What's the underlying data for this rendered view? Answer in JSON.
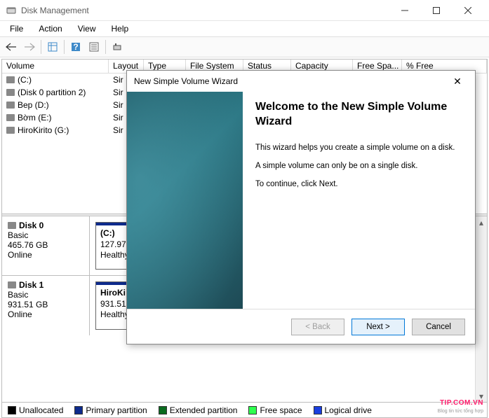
{
  "window": {
    "title": "Disk Management"
  },
  "menu": {
    "file": "File",
    "action": "Action",
    "view": "View",
    "help": "Help"
  },
  "cols": {
    "volume": "Volume",
    "layout": "Layout",
    "type": "Type",
    "filesystem": "File System",
    "status": "Status",
    "capacity": "Capacity",
    "freespace": "Free Spa...",
    "pctfree": "% Free"
  },
  "volumes": [
    {
      "name": "(C:)",
      "layout": "Sir"
    },
    {
      "name": "(Disk 0 partition 2)",
      "layout": "Sir"
    },
    {
      "name": "Bep (D:)",
      "layout": "Sir"
    },
    {
      "name": "Bờm (E:)",
      "layout": "Sir"
    },
    {
      "name": "HiroKirito (G:)",
      "layout": "Sir"
    }
  ],
  "disks": [
    {
      "name": "Disk 0",
      "type": "Basic",
      "size": "465.76 GB",
      "status": "Online",
      "partitions": [
        {
          "label": "(C:)",
          "size": "127.97",
          "status": "Healthy"
        }
      ]
    },
    {
      "name": "Disk 1",
      "type": "Basic",
      "size": "931.51 GB",
      "status": "Online",
      "partitions": [
        {
          "label": "HiroKi",
          "size": "931.51",
          "status": "Healthy (Active, Primary Partition)"
        }
      ]
    }
  ],
  "legend": {
    "unallocated": "Unallocated",
    "primary": "Primary partition",
    "extended": "Extended partition",
    "freespace": "Free space",
    "logical": "Logical drive"
  },
  "legend_colors": {
    "unallocated": "#000000",
    "primary": "#0d2a8c",
    "extended": "#0a6b1f",
    "freespace": "#2fff4e",
    "logical": "#1a3fe0"
  },
  "dialog": {
    "title": "New Simple Volume Wizard",
    "heading": "Welcome to the New Simple Volume Wizard",
    "line1": "This wizard helps you create a simple volume on a disk.",
    "line2": "A simple volume can only be on a single disk.",
    "line3": "To continue, click Next.",
    "back": "< Back",
    "next": "Next >",
    "cancel": "Cancel"
  },
  "watermark": {
    "main": "TIP.COM.VN",
    "sub": "Blog tin tức tổng hợp"
  }
}
